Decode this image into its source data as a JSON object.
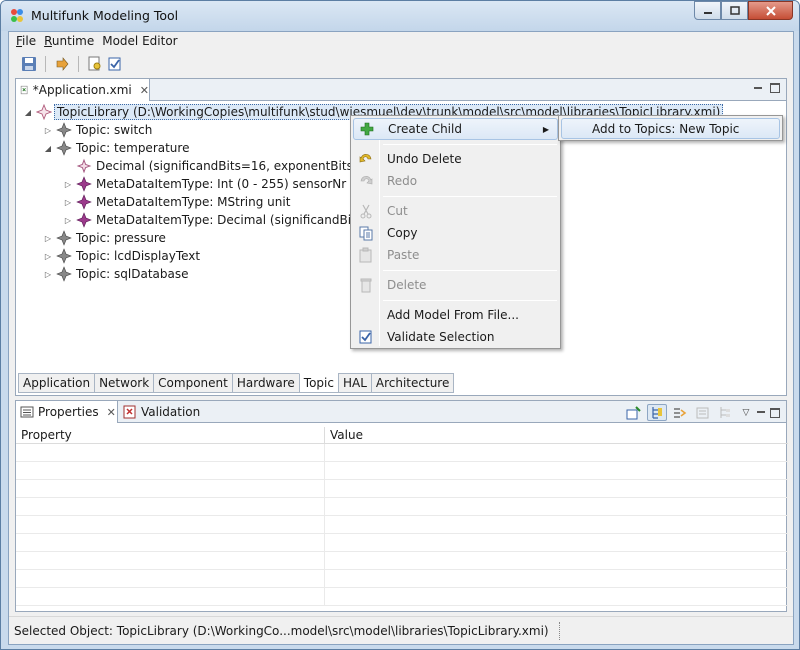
{
  "window": {
    "title": "Multifunk Modeling Tool"
  },
  "menubar": [
    {
      "label": "File",
      "mnemonic": "F",
      "rest": "ile"
    },
    {
      "label": "Runtime",
      "mnemonic": "R",
      "rest": "untime"
    },
    {
      "label": "Model Editor",
      "mnemonic": "",
      "rest": "Model Editor"
    }
  ],
  "editor": {
    "tab_label": "*Application.xmi",
    "tree": [
      {
        "label": "TopicLibrary (D:\\WorkingCopies\\multifunk\\stud\\wiesmuel\\dev\\trunk\\model\\src\\model\\libraries\\TopicLibrary.xmi)",
        "expander": "◢",
        "icon": "topic-library-icon",
        "selected": true
      },
      {
        "label": "Topic: switch",
        "expander": "▷",
        "icon": "topic-icon"
      },
      {
        "label": "Topic: temperature",
        "expander": "◢",
        "icon": "topic-icon"
      },
      {
        "label": "Decimal (significandBits=16, exponentBits=16)",
        "expander": "",
        "icon": "decimal-icon"
      },
      {
        "label": "MetaDataItemType: Int (0 - 255) sensorNr",
        "expander": "▷",
        "icon": "metadata-icon"
      },
      {
        "label": "MetaDataItemType: MString unit",
        "expander": "▷",
        "icon": "metadata-icon"
      },
      {
        "label": "MetaDataItemType: Decimal (significandBits=16",
        "expander": "▷",
        "icon": "metadata-icon"
      },
      {
        "label": "Topic: pressure",
        "expander": "▷",
        "icon": "topic-icon"
      },
      {
        "label": "Topic: lcdDisplayText",
        "expander": "▷",
        "icon": "topic-icon"
      },
      {
        "label": "Topic: sqlDatabase",
        "expander": "▷",
        "icon": "topic-icon"
      }
    ],
    "bottom_tabs": [
      "Application",
      "Network",
      "Component",
      "Hardware",
      "Topic",
      "HAL",
      "Architecture"
    ],
    "active_bottom_tab": "Topic"
  },
  "context_menu": {
    "items": [
      {
        "label": "Create Child",
        "icon": "add-icon",
        "enabled": true,
        "submenu": true,
        "highlighted": true
      },
      {
        "label": "Undo Delete",
        "icon": "undo-icon",
        "enabled": true
      },
      {
        "label": "Redo",
        "icon": "redo-icon",
        "enabled": false
      },
      {
        "label": "Cut",
        "icon": "cut-icon",
        "enabled": false
      },
      {
        "label": "Copy",
        "icon": "copy-icon",
        "enabled": true
      },
      {
        "label": "Paste",
        "icon": "paste-icon",
        "enabled": false
      },
      {
        "label": "Delete",
        "icon": "delete-icon",
        "enabled": false
      },
      {
        "label": "Add Model From File...",
        "icon": "",
        "enabled": true
      },
      {
        "label": "Validate Selection",
        "icon": "validate-icon",
        "enabled": true
      }
    ],
    "submenu_item": "Add to Topics: New Topic"
  },
  "properties": {
    "tab_label": "Properties",
    "other_tab_label": "Validation",
    "columns": [
      "Property",
      "Value"
    ]
  },
  "status": {
    "text": "Selected Object: TopicLibrary (D:\\WorkingCo...model\\src\\model\\libraries\\TopicLibrary.xmi)"
  }
}
